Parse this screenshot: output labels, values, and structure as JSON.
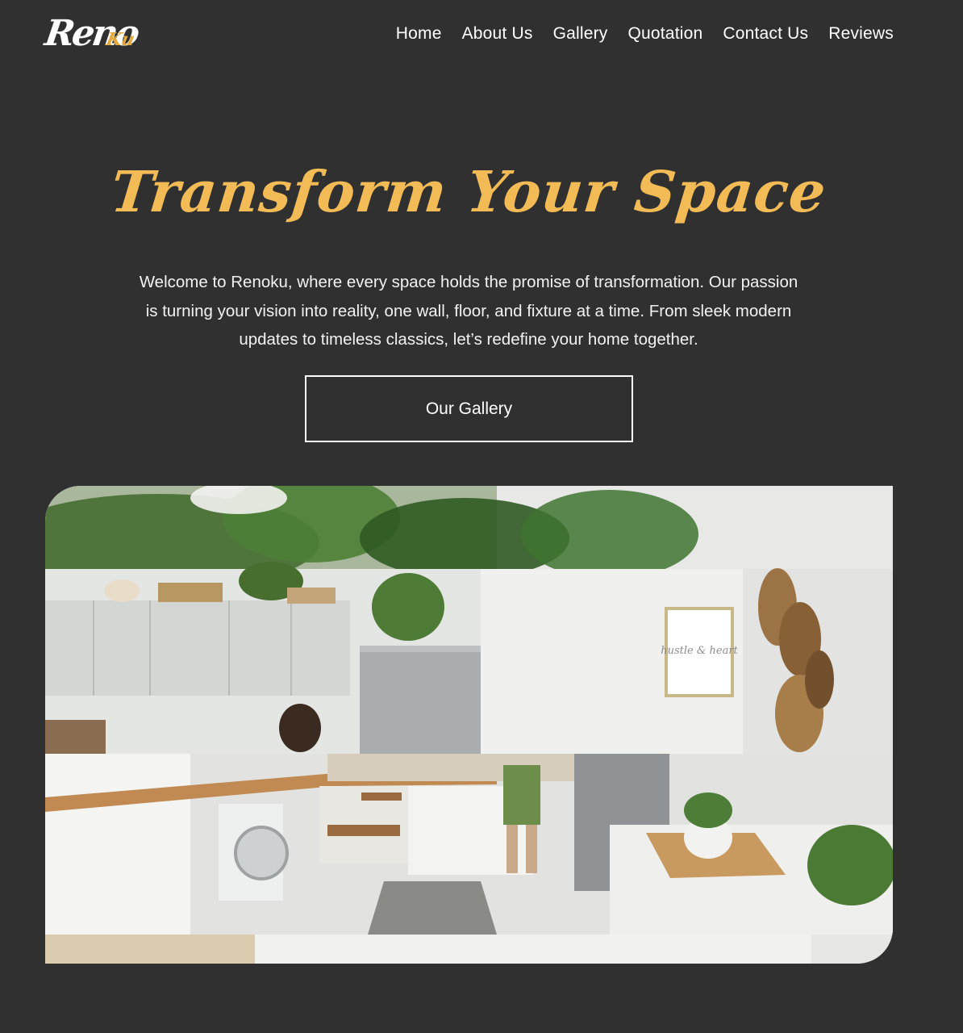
{
  "header": {
    "logo": {
      "part1": "Reno",
      "part2": "Ku"
    },
    "nav": [
      "Home",
      "About Us",
      "Gallery",
      "Quotation",
      "Contact Us",
      "Reviews"
    ]
  },
  "hero": {
    "title": "Transform Your Space",
    "text": "Welcome to Renoku, where every space holds the promise of transformation. Our passion is turning your vision into reality, one wall, floor, and fixture at a time. From sleek modern updates to timeless classics, let’s redefine your home together.",
    "button_label": "Our Gallery"
  },
  "media": {
    "frame_text": "hustle & heart"
  },
  "colors": {
    "background": "#303030",
    "accent": "#f3bb56",
    "text": "#ffffff"
  }
}
